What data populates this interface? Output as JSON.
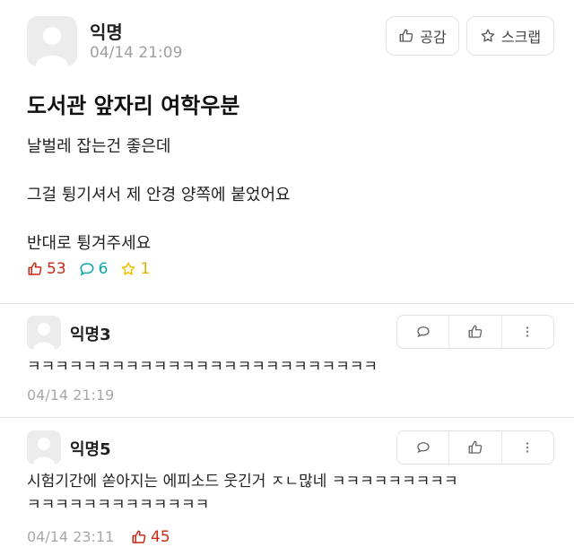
{
  "post": {
    "author": "익명",
    "time": "04/14 21:09",
    "like_button_label": "공감",
    "scrap_button_label": "스크랩",
    "title": "도서관 앞자리 여학우분",
    "body": [
      "날벌레 잡는건 좋은데",
      "그걸 튕기셔서 제 안경 양쪽에 붙었어요",
      "반대로 튕겨주세요"
    ],
    "likes": "53",
    "comments": "6",
    "scraps": "1"
  },
  "comments": [
    {
      "author": "익명3",
      "text_lines": [
        "ㅋㅋㅋㅋㅋㅋㅋㅋㅋㅋㅋㅋㅋㅋㅋㅋㅋㅋㅋㅋㅋㅋㅋㅋㅋ"
      ],
      "time": "04/14 21:19"
    },
    {
      "author": "익명5",
      "text_lines": [
        "시험기간에 쏟아지는 에피소드 웃긴거 ㅈㄴ많네 ㅋㅋㅋㅋㅋㅋㅋㅋㅋ",
        "ㅋㅋㅋㅋㅋㅋㅋㅋㅋㅋㅋㅋㅋ"
      ],
      "time": "04/14 23:11",
      "likes": "45"
    }
  ],
  "colors": {
    "like": "#c62917",
    "comment": "#0ca5b0",
    "scrap": "#f0c000"
  }
}
